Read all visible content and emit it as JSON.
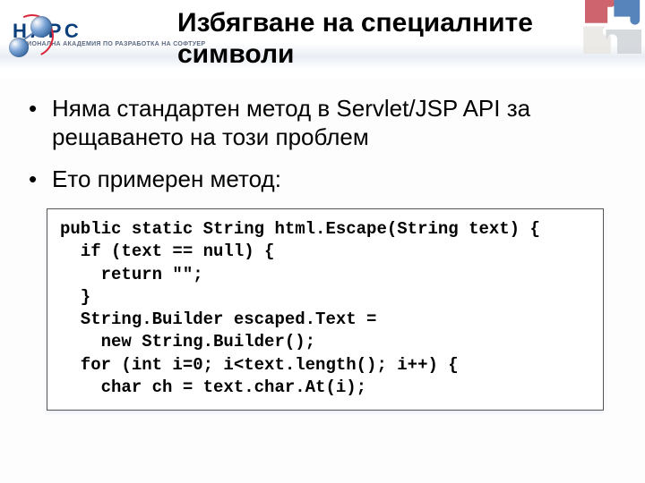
{
  "header": {
    "logo": {
      "text_big": "НАРС",
      "text_small": "НАЦИОНАЛНА АКАДЕМИЯ ПО РАЗРАБОТКА НА СОФТУЕР"
    },
    "title_line1": "Избягване на специалните",
    "title_line2": "символи"
  },
  "bullets": [
    "Няма стандартен метод в Servlet/JSP API за рещаването на този проблем",
    "Ето примерен метод:"
  ],
  "code": "public static String html.Escape(String text) {\n  if (text == null) {\n    return \"\";\n  }\n  String.Builder escaped.Text =\n    new String.Builder();\n  for (int i=0; i<text.length(); i++) {\n    char ch = text.char.At(i);"
}
